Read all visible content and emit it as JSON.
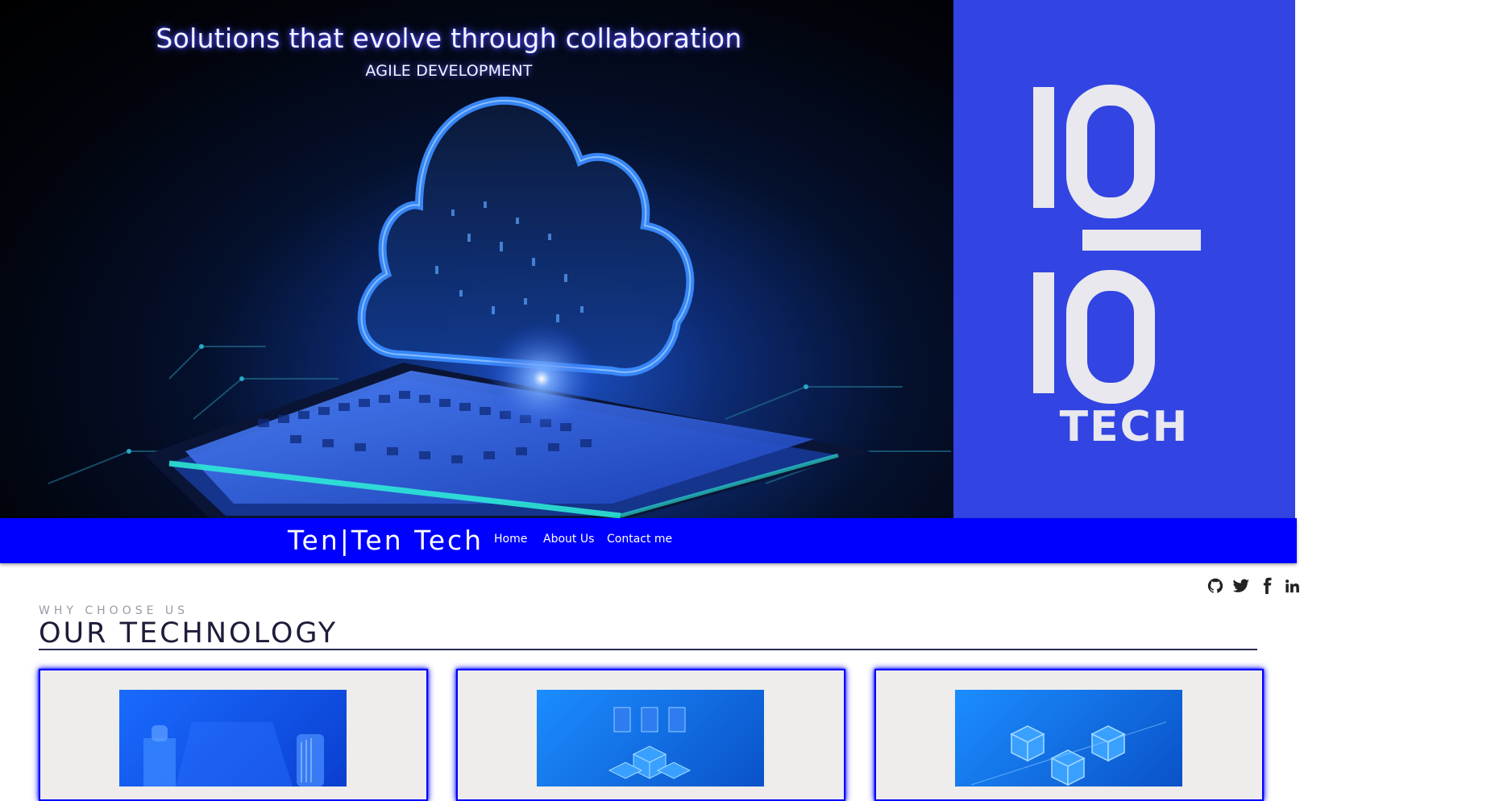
{
  "hero": {
    "title": "Solutions that evolve through collaboration",
    "subtitle": "AGILE DEVELOPMENT",
    "image": "cloud-over-chip-illustration",
    "logo": {
      "word": "TECH",
      "background": "#3244e2",
      "mark": "1010"
    }
  },
  "nav": {
    "brand": "Ten|Ten Tech",
    "links": [
      {
        "label": "Home"
      },
      {
        "label": "About Us"
      },
      {
        "label": "Contact me"
      }
    ],
    "background": "#0000ff"
  },
  "social": [
    {
      "icon": "github-icon"
    },
    {
      "icon": "twitter-icon"
    },
    {
      "icon": "facebook-icon"
    },
    {
      "icon": "linkedin-icon"
    }
  ],
  "section": {
    "eyebrow": "WHY CHOOSE US",
    "title": "OUR TECHNOLOGY",
    "accent": "#0000ff"
  },
  "cards": [
    {
      "image": "isometric-server-illustration"
    },
    {
      "image": "isometric-data-illustration"
    },
    {
      "image": "isometric-blocks-illustration"
    }
  ]
}
